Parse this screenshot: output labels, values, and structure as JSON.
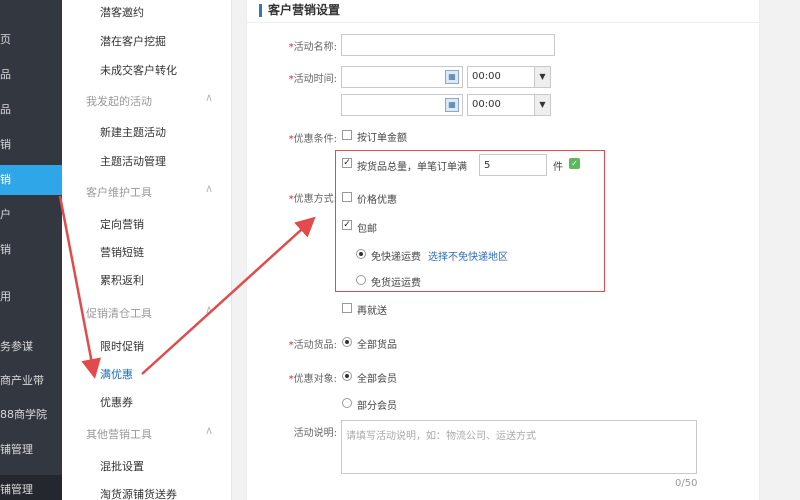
{
  "left_nav": {
    "items": [
      {
        "label": "页"
      },
      {
        "label": "品"
      },
      {
        "label": "品"
      },
      {
        "label": "销"
      },
      {
        "label": "销"
      },
      {
        "label": "户"
      },
      {
        "label": "销"
      },
      {
        "label": "用"
      },
      {
        "label": "务参谋"
      },
      {
        "label": "商产业带"
      },
      {
        "label": "88商学院"
      },
      {
        "label": "铺管理"
      },
      {
        "label": "铺管理"
      }
    ]
  },
  "submenu": {
    "items": [
      {
        "label": "潜客邀约"
      },
      {
        "label": "潜在客户挖掘"
      },
      {
        "label": "未成交客户转化"
      },
      {
        "label": "我发起的活动"
      },
      {
        "label": "新建主题活动"
      },
      {
        "label": "主题活动管理"
      },
      {
        "label": "客户维护工具"
      },
      {
        "label": "定向营销"
      },
      {
        "label": "营销短链"
      },
      {
        "label": "累积返利"
      },
      {
        "label": "促销清仓工具"
      },
      {
        "label": "限时促销"
      },
      {
        "label": "满优惠"
      },
      {
        "label": "优惠券"
      },
      {
        "label": "其他营销工具"
      },
      {
        "label": "混批设置"
      },
      {
        "label": "淘货源铺货送券"
      }
    ]
  },
  "form": {
    "title": "客户营销设置",
    "labels": {
      "name": "活动名称:",
      "time": "活动时间:",
      "condition": "优惠条件:",
      "method": "优惠方式:",
      "products": "活动货品:",
      "target": "优惠对象:",
      "desc": "活动说明:"
    },
    "time_select_1": "00:00",
    "time_select_2": "00:00",
    "cond_option": "按订单金额",
    "cond_option2": "按货品总量，单笔订单满",
    "cond_value": "5",
    "cond_unit": "件",
    "method_price": "价格优惠",
    "method_free_shipping": "包邮",
    "free_express": "免快递运费",
    "choose_region": "选择不免快递地区",
    "free_freight": "免货运运费",
    "method_gift": "再就送",
    "products_all": "全部货品",
    "target_all": "全部会员",
    "target_some": "部分会员",
    "desc_placeholder": "请填写活动说明，如：物流公司、运送方式",
    "counter": "0/50"
  },
  "colors": {
    "accent_blue": "#2ea6e8",
    "annotation_red": "#e24b4b"
  }
}
